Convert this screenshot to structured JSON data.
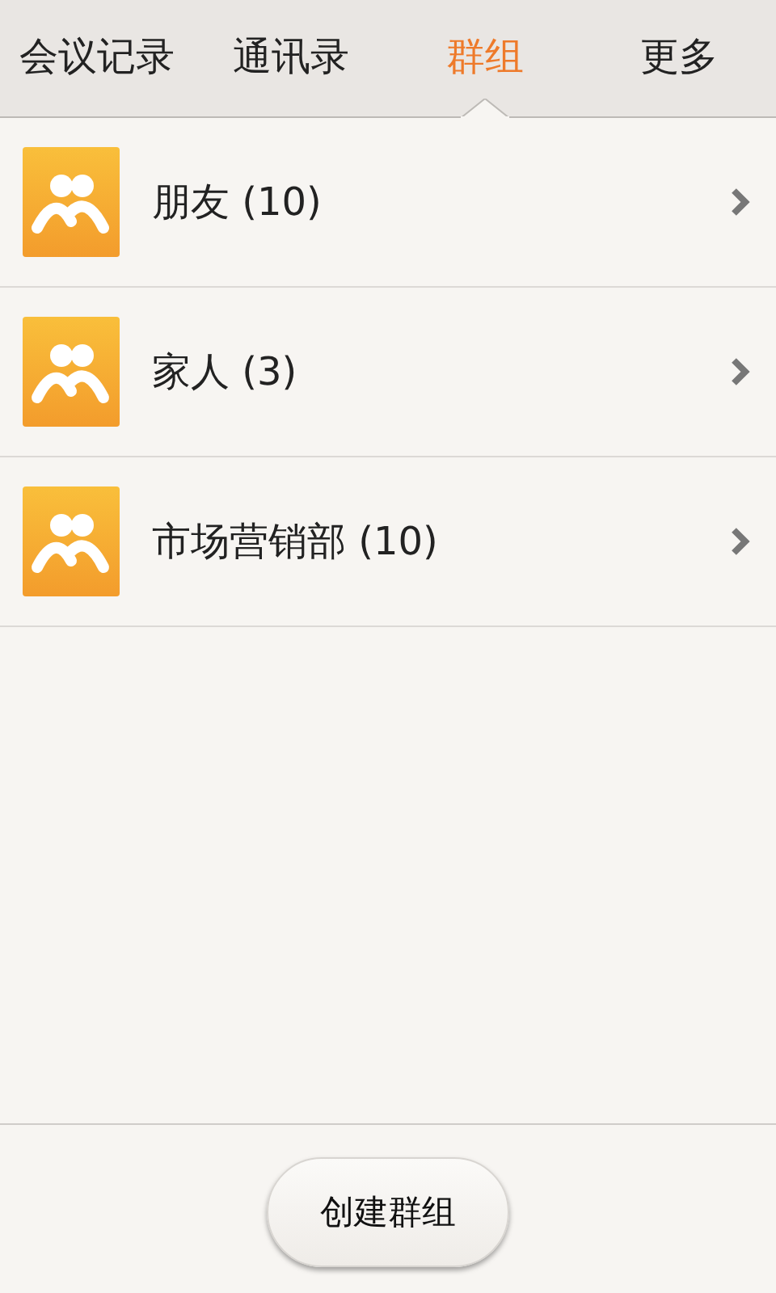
{
  "tabs": [
    {
      "label": "会议记录",
      "selected": false
    },
    {
      "label": "通讯录",
      "selected": false
    },
    {
      "label": "群组",
      "selected": true
    },
    {
      "label": "更多",
      "selected": false
    }
  ],
  "groups": [
    {
      "name": "朋友 (10)"
    },
    {
      "name": "家人 (3)"
    },
    {
      "name": "市场营销部 (10)"
    }
  ],
  "create_button": "创建群组"
}
